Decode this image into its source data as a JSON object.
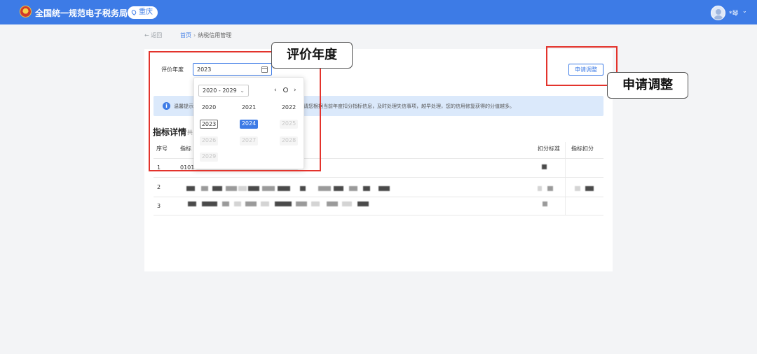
{
  "header": {
    "app_title": "全国统一规范电子税务局",
    "region": "重庆",
    "user_name": "*琴",
    "logo_icon": "tax-emblem",
    "brand_color": "#3d7be6"
  },
  "nav": {
    "back": "← 返回",
    "breadcrumb_home": "首页",
    "breadcrumb_separator": "›",
    "breadcrumb_current": "纳税信用管理"
  },
  "filter": {
    "year_label": "评价年度",
    "year_value": "2023",
    "apply_button": "申请调整"
  },
  "notice": {
    "prefix": "温馨提示",
    "rest": "请您根据当前年度扣分指标信息，及时处理失信事项，越早处理，您的信用修复获得的分值越多。",
    "icon": "info-icon"
  },
  "details": {
    "title": "指标详情",
    "count_prefix": "共",
    "columns": [
      "序号",
      "指标",
      "扣分标准",
      "指标扣分"
    ],
    "rows": [
      {
        "index": "1",
        "code": "0101"
      },
      {
        "index": "2",
        "code": ""
      },
      {
        "index": "3",
        "code": ""
      }
    ]
  },
  "year_picker": {
    "decade": "2020 - 2029",
    "prev": "‹",
    "next": "›",
    "years": [
      {
        "label": "2020",
        "state": "normal"
      },
      {
        "label": "2021",
        "state": "normal"
      },
      {
        "label": "2022",
        "state": "normal"
      },
      {
        "label": "2023",
        "state": "current"
      },
      {
        "label": "2024",
        "state": "selected"
      },
      {
        "label": "2025",
        "state": "disabled"
      },
      {
        "label": "2026",
        "state": "disabled"
      },
      {
        "label": "2027",
        "state": "disabled"
      },
      {
        "label": "2028",
        "state": "disabled"
      },
      {
        "label": "2029",
        "state": "disabled"
      }
    ]
  },
  "annotations": {
    "year_callout": "评价年度",
    "apply_callout": "申请调整",
    "highlight_color": "#e3332c"
  }
}
